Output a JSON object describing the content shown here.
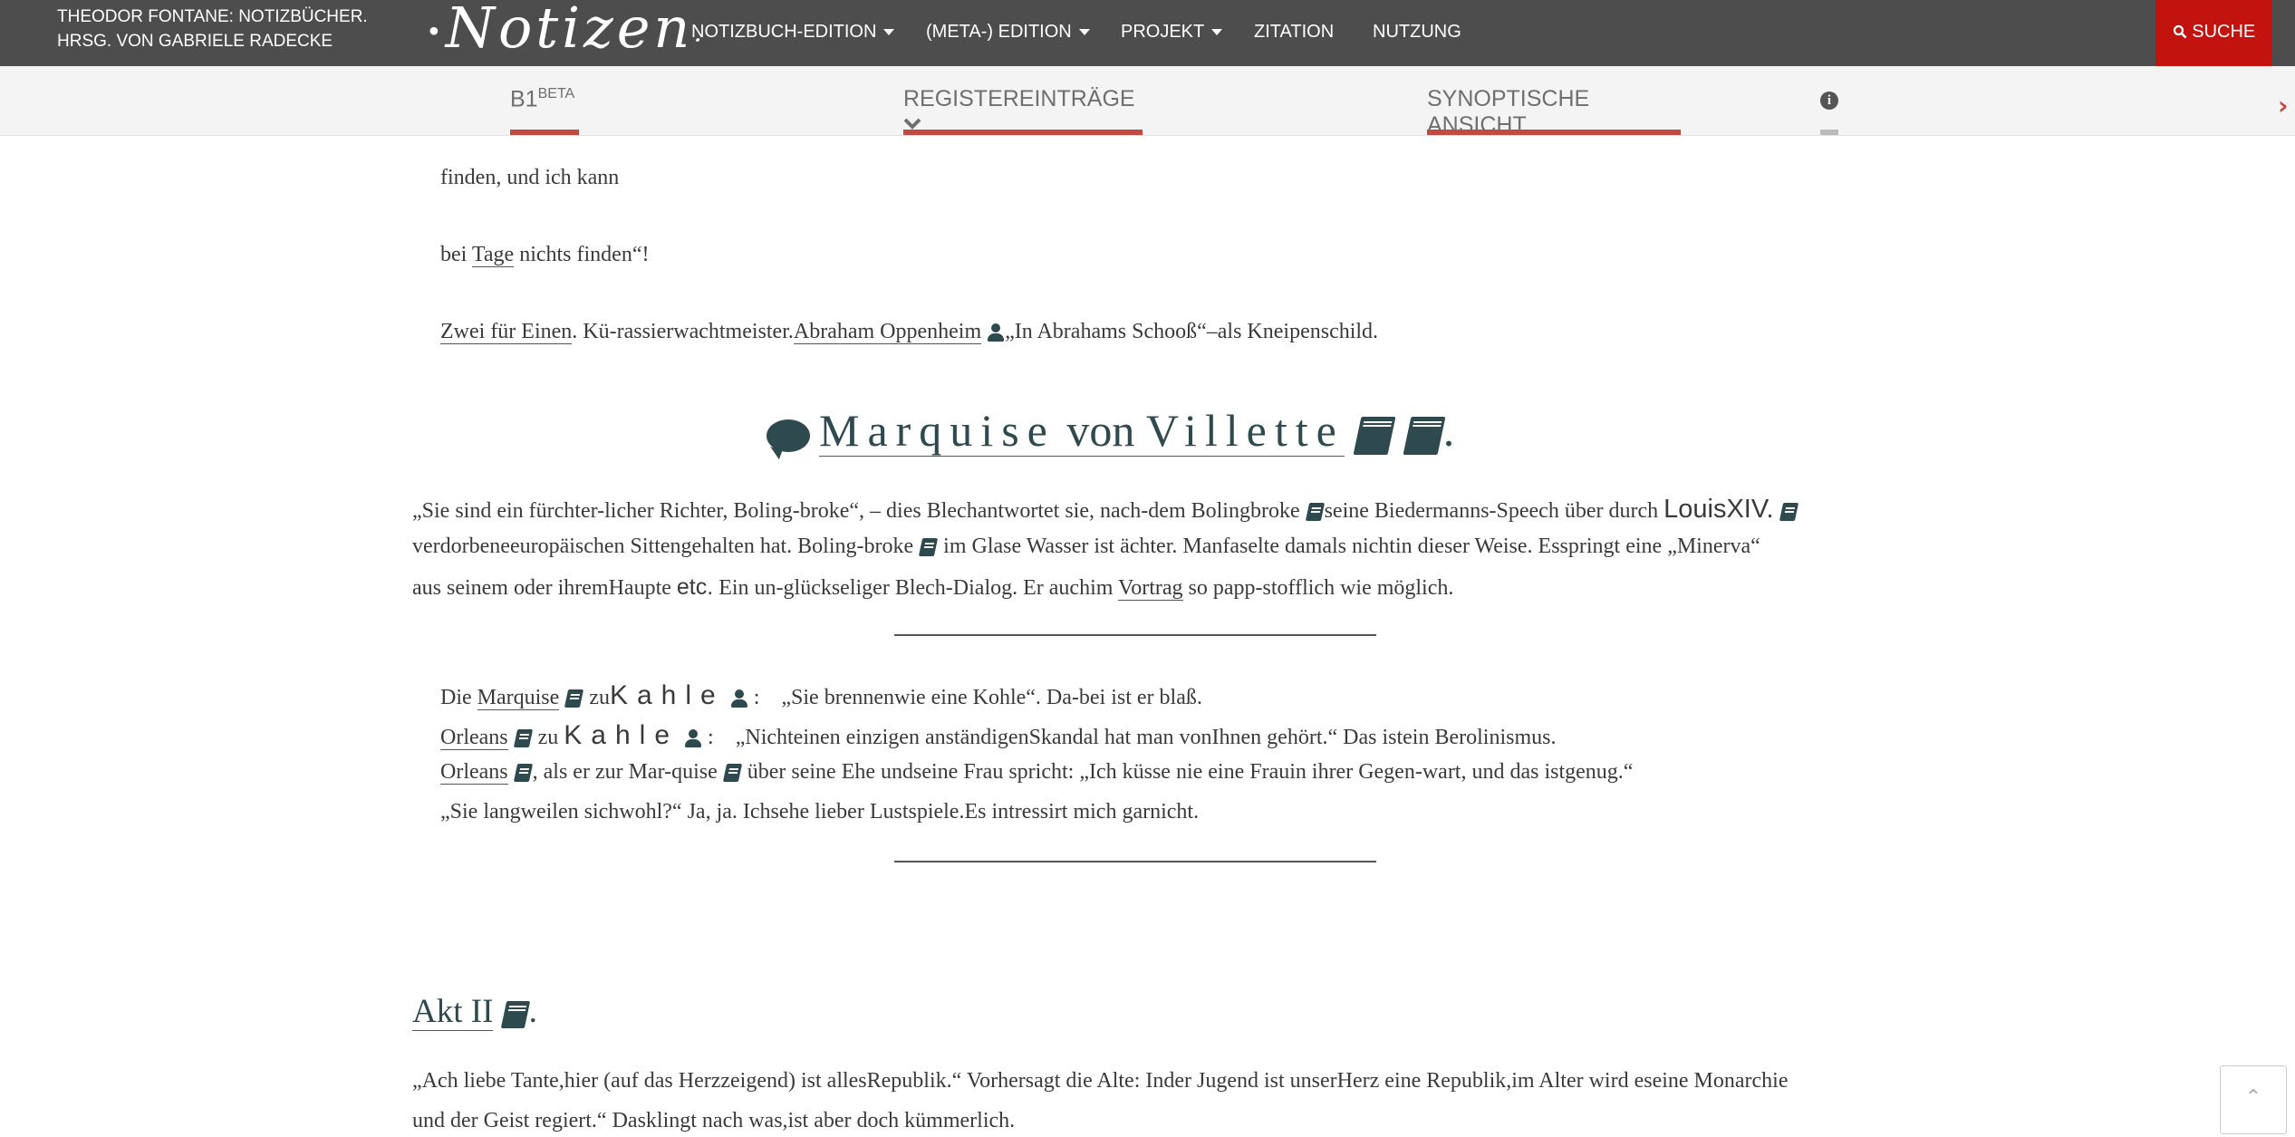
{
  "header": {
    "brand_line1": "THEODOR FONTANE: NOTIZBÜCHER.",
    "brand_line2": "HRSG. VON GABRIELE RADECKE",
    "logo": "Notizen",
    "nav": [
      "NOTIZBUCH-EDITION",
      "(META-) EDITION",
      "PROJEKT",
      "ZITATION",
      "NUTZUNG"
    ],
    "search_label": "SUCHE"
  },
  "subnav": {
    "tab1": "B1",
    "tab1_sup": "BETA",
    "tab2": "REGISTEREINTRÄGE",
    "tab3": "SYNOPTISCHE ANSICHT",
    "info": "i"
  },
  "content": {
    "line1": "finden, und ich kann",
    "line2a": "bei ",
    "line2b": "Tage",
    "line2c": " nichts finden“!",
    "line3a": "Zwei für Einen",
    "line3b": ". Kü-rassierwachtmeister.",
    "line3c": "Abraham Oppenheim",
    "line3d": "„In Abrahams Schooß“–als Kneipenschild.",
    "heading_a": "Marquise",
    "heading_b": "von",
    "heading_c": "Villette",
    "heading_end": ".",
    "para1_l1a": "„Sie sind ein fürchter-licher Richter, Boling-broke“, – dies Blechantwortet sie, nach-dem Bolingbroke",
    "para1_l1b": "seine Biedermanns-Speech über durch",
    "para1_l1c": "LouisXIV.",
    "para1_l2a": "verdorbeneeuropäischen Sittengehalten hat. Boling-broke",
    "para1_l2b": "im Glase Wasser ist ächter. Manfaselte damals nichtin dieser Weise. Esspringt eine „Minerva“",
    "para1_l3a": "aus seinem oder ihremHaupte",
    "para1_l3b": "etc.",
    "para1_l3c": "Ein un-glückseliger Blech-Dialog. Er auchim",
    "para1_l3d": "Vortrag",
    "para1_l3e": "so papp-stofflich wie möglich.",
    "d1a": "Die",
    "d1b": "Marquise",
    "d1c": "zu",
    "d1d": "Kahle",
    "d1e": ":",
    "d1f": "„Sie brennenwie eine Kohle“. Da-bei ist er blaß.",
    "d2a": "Orleans",
    "d2b": "zu",
    "d2c": "Kahle",
    "d2d": ":",
    "d2e": "„Nichteinen einzigen anständigenSkandal hat man vonIhnen gehört.“ Das istein Berolinismus.",
    "d3a": "Orleans",
    "d3b": ", als er zur Mar-quise",
    "d3c": "über seine Ehe undseine Frau spricht: „Ich küsse nie eine Frauin ihrer Gegen-wart, und das istgenug.“",
    "d4": "„Sie langweilen sichwohl?“ Ja, ja. Ichsehe lieber Lustspiele.Es intressirt mich garnicht.",
    "akt_a": "Akt II",
    "akt_b": ".",
    "last_l1": "„Ach liebe Tante,hier (auf das Herzzeigend) ist allesRepublik.“ Vorhersagt die Alte: Inder Jugend ist unserHerz eine Republik,im Alter wird eseine Monarchie",
    "last_l2": "und der Geist regiert.“ Dasklingt nach was,ist aber doch kümmerlich."
  },
  "icons": {
    "person": "person-icon",
    "book": "book-icon",
    "comment": "comment-icon",
    "search": "search-icon",
    "info": "info-icon",
    "next": "chevron-right-icon",
    "scroll_top": "chevron-up-icon"
  },
  "colors": {
    "topbar": "#4d4d4d",
    "search": "#c2130f",
    "accent": "#c24a41",
    "icon": "#2e4a4f"
  }
}
